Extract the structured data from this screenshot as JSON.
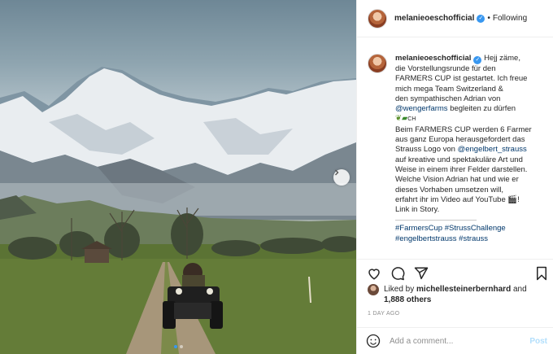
{
  "post": {
    "username": "melanieoeschofficial",
    "follow_status": "Following",
    "caption_lines": [
      "Hejj zäme,",
      "die Vorstellungsrunde für den",
      "FARMERS CUP ist gestartet. Ich freue",
      "mich mega Team Switzerland &",
      "den sympathischen Adrian von",
      "begleiten zu dürfen",
      "CH",
      "Beim FARMERS CUP werden 6 Farmer",
      "aus ganz Europa herausgefordert das",
      "Strauss Logo von",
      "auf kreative und spektakuläre Art und",
      "Weise in einem ihrer Felder darstellen.",
      "Welche Vision Adrian hat und wie er",
      "dieses Vorhaben umsetzen will,",
      "erfahrt ihr im Video auf YouTube",
      "Link in Story."
    ],
    "mentions": {
      "wengerfarms": "@wengerfarms",
      "engelbert": "@engelbert_strauss"
    },
    "hashtags_line1": "#FarmersCup #StrussChallenge",
    "hashtags_line2": "#engelbertstrauss #strauss",
    "liked_by_prefix": "Liked by",
    "liked_by_user": "michellesteinerbernhard",
    "liked_by_and": "and",
    "likes_count": "1,888 others",
    "timestamp": "1 DAY AGO",
    "comment_placeholder": "Add a comment...",
    "post_label": "Post",
    "carousel": {
      "slides": 2,
      "active": 1
    }
  },
  "colors": {
    "link": "#00376b",
    "verified": "#3897f0",
    "post_button": "#b2dffc"
  },
  "icons": [
    "heart-icon",
    "comment-icon",
    "share-icon",
    "bookmark-icon",
    "emoji-icon",
    "chevron-right-icon",
    "verified-badge-icon",
    "plant-emoji",
    "tractor-emoji",
    "clapperboard-emoji"
  ]
}
